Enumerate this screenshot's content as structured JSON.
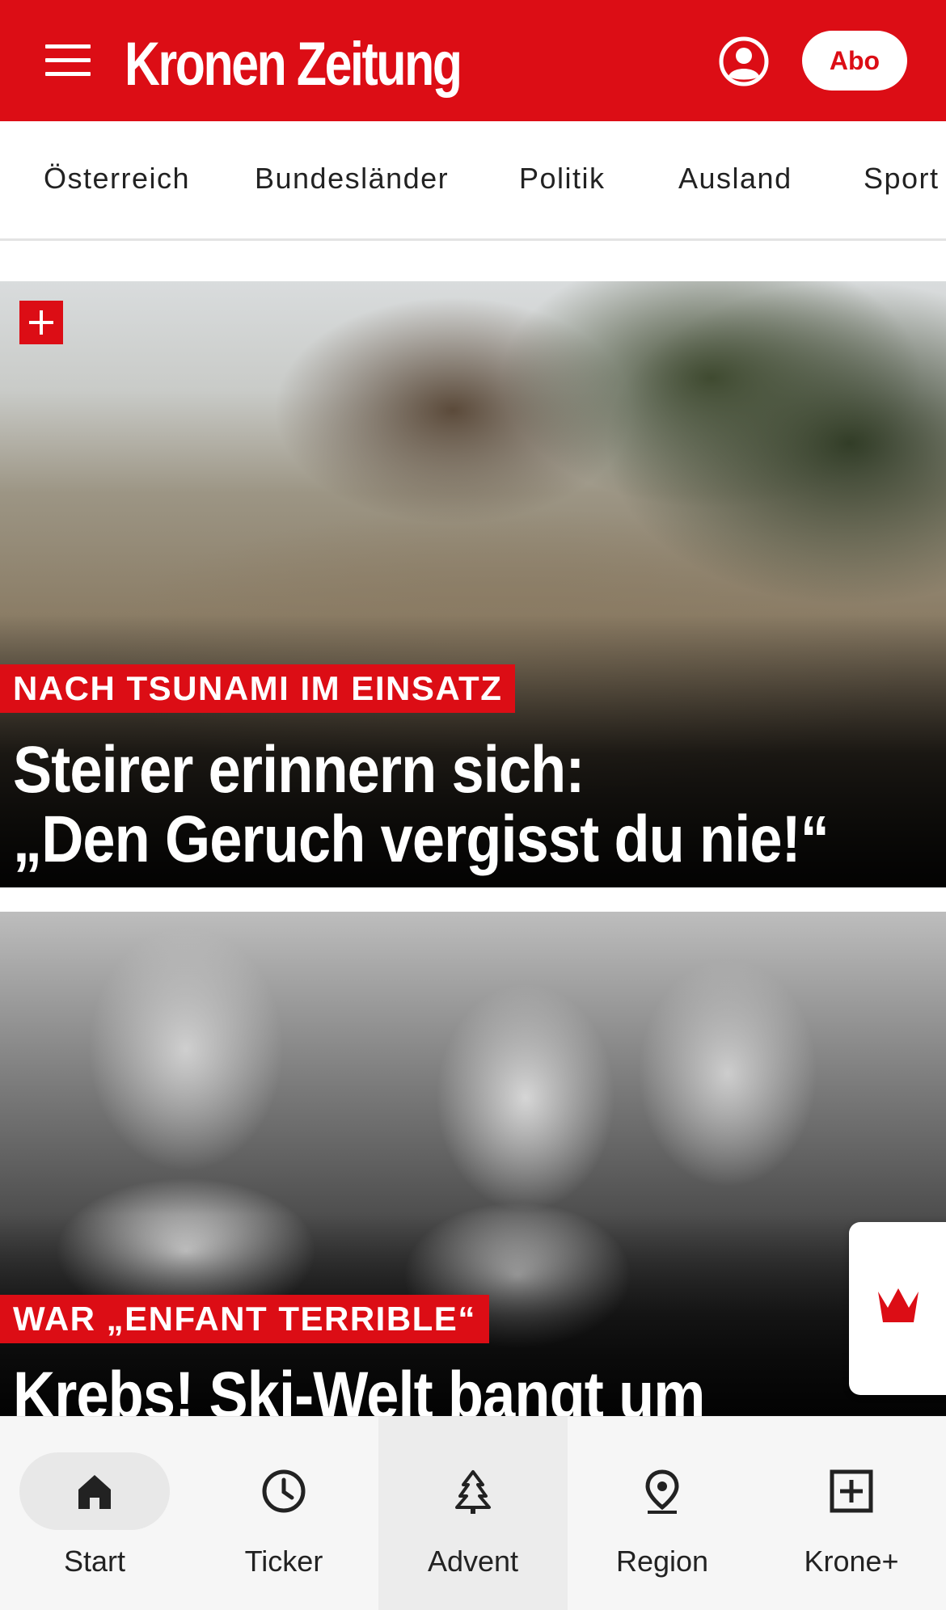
{
  "header": {
    "logo_text": "Kronen Zeitung",
    "abo_label": "Abo",
    "brand_color": "#dc0d15"
  },
  "categories": [
    "Österreich",
    "Bundesländer",
    "Politik",
    "Ausland",
    "Sport"
  ],
  "articles": [
    {
      "kicker": "NACH TSUNAMI IM EINSATZ",
      "headline_line1": "Steirer erinnern sich:",
      "headline_line2": "„Den Geruch vergisst du nie!“",
      "plus_badge": true
    },
    {
      "kicker": "WAR „ENFANT TERRIBLE“",
      "headline_line1": "Krebs! Ski-Welt bangt um",
      "plus_badge": false
    }
  ],
  "bottom_nav": [
    {
      "label": "Start",
      "icon": "home-icon",
      "active": true
    },
    {
      "label": "Ticker",
      "icon": "clock-icon",
      "active": false
    },
    {
      "label": "Advent",
      "icon": "tree-icon",
      "active": false
    },
    {
      "label": "Region",
      "icon": "location-pin-icon",
      "active": false
    },
    {
      "label": "Krone+",
      "icon": "plus-box-icon",
      "active": false
    }
  ]
}
